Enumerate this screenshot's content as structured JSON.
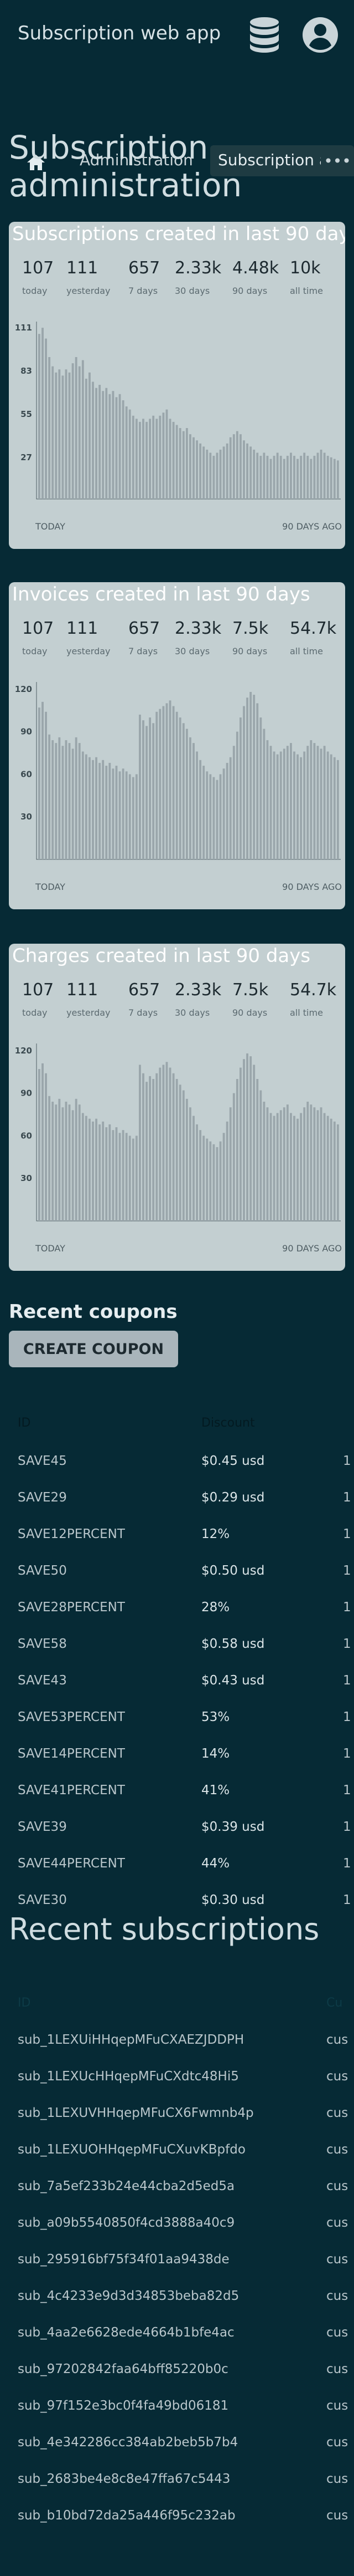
{
  "app_title": "Subscription web app",
  "nav": {
    "admin_label": "Administration",
    "subs_label": "Subscription admin",
    "more_label": "•••"
  },
  "page_title": "Subscription administration",
  "cards": [
    {
      "title": "Subscriptions created in last 90 days",
      "stats": [
        {
          "value": "107",
          "label": "today"
        },
        {
          "value": "111",
          "label": "yesterday"
        },
        {
          "value": "657",
          "label": "7 days"
        },
        {
          "value": "2.33k",
          "label": "30 days"
        },
        {
          "value": "4.48k",
          "label": "90 days"
        },
        {
          "value": "10k",
          "label": "all time"
        }
      ],
      "x_left": "TODAY",
      "x_right": "90 DAYS AGO"
    },
    {
      "title": "Invoices created in last 90 days",
      "stats": [
        {
          "value": "107",
          "label": "today"
        },
        {
          "value": "111",
          "label": "yesterday"
        },
        {
          "value": "657",
          "label": "7 days"
        },
        {
          "value": "2.33k",
          "label": "30 days"
        },
        {
          "value": "7.5k",
          "label": "90 days"
        },
        {
          "value": "54.7k",
          "label": "all time"
        }
      ],
      "x_left": "TODAY",
      "x_right": "90 DAYS AGO"
    },
    {
      "title": "Charges created in last 90 days",
      "stats": [
        {
          "value": "107",
          "label": "today"
        },
        {
          "value": "111",
          "label": "yesterday"
        },
        {
          "value": "657",
          "label": "7 days"
        },
        {
          "value": "2.33k",
          "label": "30 days"
        },
        {
          "value": "7.5k",
          "label": "90 days"
        },
        {
          "value": "54.7k",
          "label": "all time"
        }
      ],
      "x_left": "TODAY",
      "x_right": "90 DAYS AGO"
    }
  ],
  "chart_data": [
    {
      "type": "bar",
      "ylim": [
        0,
        115
      ],
      "yticks": [
        27,
        55,
        83,
        111
      ],
      "values": [
        107,
        111,
        104,
        92,
        86,
        82,
        84,
        80,
        84,
        82,
        88,
        92,
        86,
        90,
        78,
        82,
        76,
        72,
        74,
        70,
        72,
        68,
        70,
        66,
        68,
        64,
        60,
        58,
        54,
        52,
        50,
        52,
        50,
        52,
        54,
        52,
        54,
        56,
        58,
        52,
        50,
        48,
        46,
        44,
        46,
        42,
        40,
        38,
        36,
        34,
        32,
        30,
        28,
        30,
        32,
        34,
        36,
        40,
        42,
        44,
        42,
        38,
        36,
        34,
        32,
        30,
        28,
        30,
        28,
        26,
        28,
        30,
        28,
        26,
        28,
        30,
        28,
        26,
        28,
        30,
        28,
        26,
        28,
        30,
        32,
        30,
        28,
        27,
        26,
        25
      ]
    },
    {
      "type": "bar",
      "ylim": [
        0,
        125
      ],
      "yticks": [
        30,
        60,
        90,
        120
      ],
      "values": [
        107,
        111,
        104,
        88,
        84,
        82,
        86,
        80,
        84,
        82,
        78,
        86,
        82,
        76,
        74,
        72,
        70,
        72,
        68,
        70,
        66,
        68,
        64,
        66,
        62,
        64,
        62,
        60,
        58,
        60,
        102,
        98,
        94,
        100,
        96,
        104,
        106,
        108,
        110,
        112,
        108,
        104,
        100,
        96,
        92,
        86,
        82,
        76,
        70,
        66,
        62,
        60,
        58,
        56,
        60,
        64,
        68,
        72,
        80,
        90,
        100,
        108,
        114,
        118,
        116,
        110,
        100,
        92,
        84,
        80,
        76,
        74,
        76,
        78,
        80,
        82,
        76,
        74,
        72,
        76,
        80,
        84,
        82,
        80,
        78,
        80,
        76,
        74,
        72,
        70
      ]
    },
    {
      "type": "bar",
      "ylim": [
        0,
        125
      ],
      "yticks": [
        30,
        60,
        90,
        120
      ],
      "values": [
        107,
        111,
        104,
        88,
        84,
        82,
        86,
        80,
        84,
        82,
        78,
        86,
        82,
        76,
        74,
        72,
        70,
        72,
        68,
        70,
        66,
        68,
        64,
        66,
        62,
        64,
        62,
        60,
        58,
        60,
        110,
        104,
        98,
        102,
        100,
        104,
        108,
        110,
        112,
        108,
        104,
        100,
        96,
        92,
        86,
        80,
        74,
        68,
        64,
        60,
        58,
        56,
        54,
        52,
        56,
        62,
        70,
        80,
        90,
        100,
        108,
        114,
        118,
        116,
        110,
        100,
        92,
        84,
        80,
        76,
        74,
        76,
        78,
        80,
        82,
        76,
        74,
        72,
        76,
        80,
        84,
        82,
        80,
        78,
        80,
        76,
        74,
        72,
        70,
        68
      ]
    }
  ],
  "coupons": {
    "heading": "Recent coupons",
    "create_label": "CREATE COUPON",
    "col_id": "ID",
    "col_discount": "Discount",
    "rows": [
      {
        "id": "SAVE45",
        "discount": "$0.45 usd",
        "extra": "1"
      },
      {
        "id": "SAVE29",
        "discount": "$0.29 usd",
        "extra": "1"
      },
      {
        "id": "SAVE12PERCENT",
        "discount": "12%",
        "extra": "1"
      },
      {
        "id": "SAVE50",
        "discount": "$0.50 usd",
        "extra": "1"
      },
      {
        "id": "SAVE28PERCENT",
        "discount": "28%",
        "extra": "1"
      },
      {
        "id": "SAVE58",
        "discount": "$0.58 usd",
        "extra": "1"
      },
      {
        "id": "SAVE43",
        "discount": "$0.43 usd",
        "extra": "1"
      },
      {
        "id": "SAVE53PERCENT",
        "discount": "53%",
        "extra": "1"
      },
      {
        "id": "SAVE14PERCENT",
        "discount": "14%",
        "extra": "1"
      },
      {
        "id": "SAVE41PERCENT",
        "discount": "41%",
        "extra": "1"
      },
      {
        "id": "SAVE39",
        "discount": "$0.39 usd",
        "extra": "1"
      },
      {
        "id": "SAVE44PERCENT",
        "discount": "44%",
        "extra": "1"
      },
      {
        "id": "SAVE30",
        "discount": "$0.30 usd",
        "extra": "1"
      }
    ]
  },
  "subscriptions": {
    "heading": "Recent subscriptions",
    "col_id": "ID",
    "col_customer": "Cu",
    "rows": [
      {
        "id": "sub_1LEXUiHHqepMFuCXAEZJDDPH",
        "customer": "cus"
      },
      {
        "id": "sub_1LEXUcHHqepMFuCXdtc48Hi5",
        "customer": "cus"
      },
      {
        "id": "sub_1LEXUVHHqepMFuCX6Fwmnb4p",
        "customer": "cus"
      },
      {
        "id": "sub_1LEXUOHHqepMFuCXuvKBpfdo",
        "customer": "cus"
      },
      {
        "id": "sub_7a5ef233b24e44cba2d5ed5a",
        "customer": "cus"
      },
      {
        "id": "sub_a09b5540850f4cd3888a40c9",
        "customer": "cus"
      },
      {
        "id": "sub_295916bf75f34f01aa9438de",
        "customer": "cus"
      },
      {
        "id": "sub_4c4233e9d3d34853beba82d5",
        "customer": "cus"
      },
      {
        "id": "sub_4aa2e6628ede4664b1bfe4ac",
        "customer": "cus"
      },
      {
        "id": "sub_97202842faa64bff85220b0c",
        "customer": "cus"
      },
      {
        "id": "sub_97f152e3bc0f4fa49bd06181",
        "customer": "cus"
      },
      {
        "id": "sub_4e342286cc384ab2beb5b7b4",
        "customer": "cus"
      },
      {
        "id": "sub_2683be4e8c8e47ffa67c5443",
        "customer": "cus"
      },
      {
        "id": "sub_b10bd72da25a446f95c232ab",
        "customer": "cus"
      }
    ]
  },
  "colors": {
    "background": "#062a35",
    "card": "#c3cfd1",
    "bar": "#9aa6ab"
  }
}
